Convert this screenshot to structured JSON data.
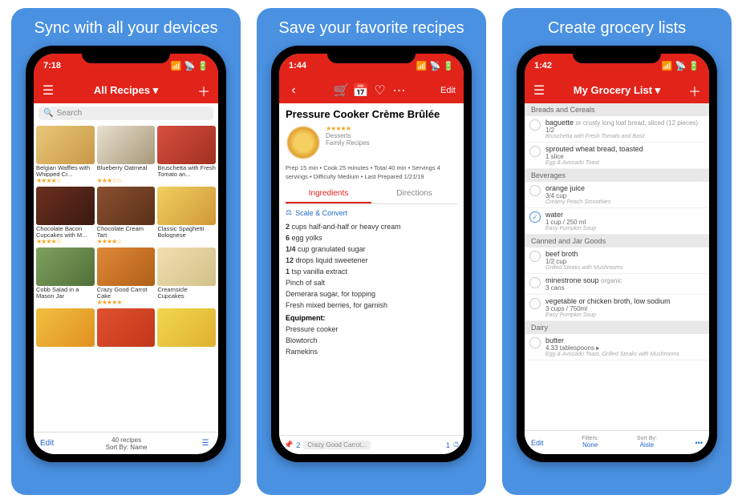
{
  "panels": [
    {
      "title": "Sync with all your devices"
    },
    {
      "title": "Save your favorite recipes"
    },
    {
      "title": "Create grocery lists"
    }
  ],
  "p1": {
    "time": "7:18",
    "nav_title": "All Recipes ▾",
    "search_placeholder": "Search",
    "cards": [
      {
        "name": "Belgian Waffles with Whipped Cr...",
        "stars": "★★★★☆"
      },
      {
        "name": "Blueberry Oatmeal",
        "stars": "★★★☆☆"
      },
      {
        "name": "Bruschetta with Fresh Tomato an...",
        "stars": ""
      },
      {
        "name": "Chocolate Bacon Cupcakes with M...",
        "stars": "★★★★☆"
      },
      {
        "name": "Chocolate Cream Tart",
        "stars": "★★★★☆"
      },
      {
        "name": "Classic Spaghetti Bolognese",
        "stars": ""
      },
      {
        "name": "Cobb Salad in a Mason Jar",
        "stars": ""
      },
      {
        "name": "Crazy Good Carrot Cake",
        "stars": "★★★★★"
      },
      {
        "name": "Creamsicle Cupcakes",
        "stars": ""
      }
    ],
    "edit": "Edit",
    "count": "40 recipes",
    "sort": "Sort By: Name"
  },
  "p2": {
    "time": "1:44",
    "edit": "Edit",
    "title": "Pressure Cooker Crème Brûlée",
    "stars": "★★★★★",
    "cat": "Desserts",
    "src": "Family Recipes",
    "prep": "Prep 15 min • Cook 25 minutes • Total 40 min • Servings 4 servings • Difficulty Medium • Last Prepared 1/21/19",
    "tab1": "Ingredients",
    "tab2": "Directions",
    "scale": "Scale & Convert",
    "ings": [
      {
        "q": "2",
        "t": "cups half-and-half or heavy cream"
      },
      {
        "q": "6",
        "t": "egg yolks"
      },
      {
        "q": "1/4",
        "t": "cup granulated sugar"
      },
      {
        "q": "12",
        "t": "drops liquid sweetener"
      },
      {
        "q": "1",
        "t": "tsp vanilla extract"
      },
      {
        "q": "",
        "t": "Pinch of salt"
      },
      {
        "q": "",
        "t": "Demerara sugar, for topping"
      },
      {
        "q": "",
        "t": "Fresh mixed berries, for garnish"
      }
    ],
    "eq_h": "Equipment:",
    "eq": [
      "Pressure cooker",
      "Blowtorch",
      "Ramekins"
    ],
    "foot_n": "2",
    "foot_chip": "Crazy Good Carrot...",
    "foot_r": "1"
  },
  "p3": {
    "time": "1:42",
    "nav_title": "My Grocery List ▾",
    "sections": [
      {
        "h": "Breads and Cereals",
        "items": [
          {
            "n": "baguette",
            "mod": "or crusty long loaf bread, sliced (12 pieces)",
            "a": "1/2",
            "s": "Bruschetta with Fresh Tomato and Basil"
          },
          {
            "n": "sprouted wheat bread, toasted",
            "a": "1 slice",
            "s": "Egg & Avocado Toast"
          }
        ]
      },
      {
        "h": "Beverages",
        "items": [
          {
            "n": "orange juice",
            "a": "3/4 cup",
            "s": "Creamy Peach Smoothies"
          },
          {
            "n": "water",
            "a": "1 cup / 250 ml",
            "s": "Easy Pumpkin Soup",
            "done": true
          }
        ]
      },
      {
        "h": "Canned and Jar Goods",
        "items": [
          {
            "n": "beef broth",
            "a": "1/2 cup",
            "s": "Grilled Steaks with Mushrooms"
          },
          {
            "n": "minestrone soup",
            "mod": "organic",
            "a": "3 cans",
            "s": ""
          },
          {
            "n": "vegetable or chicken broth, low sodium",
            "a": "3 cups / 750ml",
            "s": "Easy Pumpkin Soup"
          }
        ]
      },
      {
        "h": "Dairy",
        "items": [
          {
            "n": "butter",
            "a": "4.33 tablespoons ▸",
            "s": "Egg & Avocado Toast, Grilled Steaks with Mushrooms"
          }
        ]
      }
    ],
    "edit": "Edit",
    "f1l": "Filters:",
    "f1v": "None",
    "f2l": "Sort By:",
    "f2v": "Aisle"
  }
}
